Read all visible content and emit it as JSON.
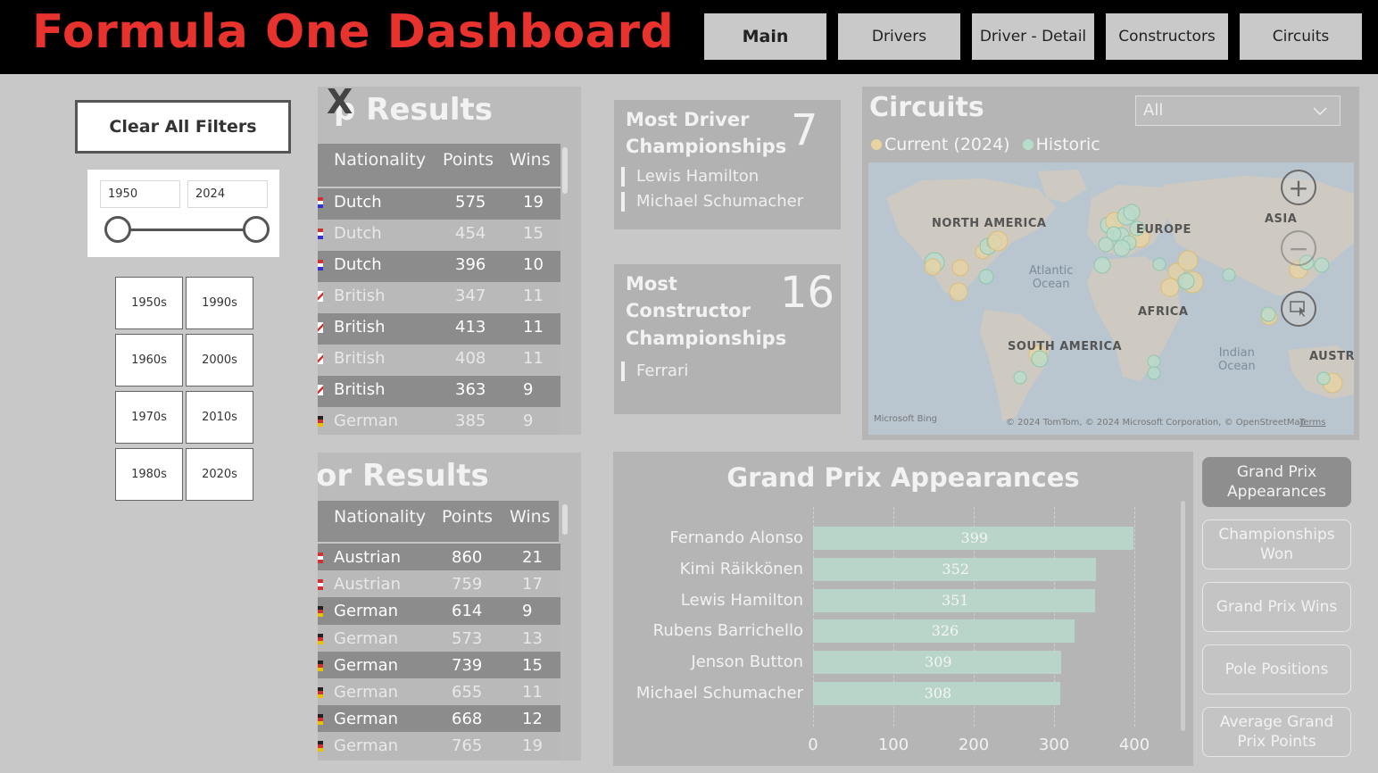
{
  "header": {
    "title": "Formula One Dashboard",
    "nav": [
      "Main",
      "Drivers",
      "Driver - Detail",
      "Constructors",
      "Circuits"
    ]
  },
  "filters": {
    "clear_label": "Clear All Filters",
    "year_from": "1950",
    "year_to": "2024",
    "decades": [
      "1950s",
      "1990s",
      "1960s",
      "2000s",
      "1970s",
      "2010s",
      "1980s",
      "2020s"
    ]
  },
  "close_label": "X",
  "driver_results": {
    "title": "p Results",
    "headers": [
      "Nationality",
      "Points",
      "Wins"
    ],
    "rows": [
      {
        "nat": "Dutch",
        "points": "575",
        "wins": "19"
      },
      {
        "nat": "Dutch",
        "points": "454",
        "wins": "15"
      },
      {
        "nat": "Dutch",
        "points": "396",
        "wins": "10"
      },
      {
        "nat": "British",
        "points": "347",
        "wins": "11"
      },
      {
        "nat": "British",
        "points": "413",
        "wins": "11"
      },
      {
        "nat": "British",
        "points": "408",
        "wins": "11"
      },
      {
        "nat": "British",
        "points": "363",
        "wins": "9"
      },
      {
        "nat": "German",
        "points": "385",
        "wins": "9"
      }
    ]
  },
  "constructor_results": {
    "title": "or Results",
    "headers": [
      "Nationality",
      "Points",
      "Wins"
    ],
    "rows": [
      {
        "nat": "Austrian",
        "points": "860",
        "wins": "21"
      },
      {
        "nat": "Austrian",
        "points": "759",
        "wins": "17"
      },
      {
        "nat": "German",
        "points": "614",
        "wins": "9"
      },
      {
        "nat": "German",
        "points": "573",
        "wins": "13"
      },
      {
        "nat": "German",
        "points": "739",
        "wins": "15"
      },
      {
        "nat": "German",
        "points": "655",
        "wins": "11"
      },
      {
        "nat": "German",
        "points": "668",
        "wins": "12"
      },
      {
        "nat": "German",
        "points": "765",
        "wins": "19"
      }
    ]
  },
  "kpi_driver": {
    "label_line1": "Most Driver",
    "label_line2": "Championships",
    "value": "7",
    "items": [
      "Lewis Hamilton",
      "Michael Schumacher"
    ]
  },
  "kpi_constructor": {
    "label_line1": "Most",
    "label_line2": "Constructor",
    "label_line3": "Championships",
    "value": "16",
    "items": [
      "Ferrari"
    ]
  },
  "circuits": {
    "title": "Circuits",
    "dropdown_value": "All",
    "legend": [
      {
        "label": "Current (2024)",
        "color": "#e9d3a0"
      },
      {
        "label": "Historic",
        "color": "#b8dccb"
      }
    ],
    "map_labels": [
      "NORTH AMERICA",
      "EUROPE",
      "ASIA",
      "AFRICA",
      "SOUTH AMERICA",
      "AUSTRA"
    ],
    "ocean_labels": [
      "Atlantic\nOcean",
      "Indian\nOcean"
    ],
    "attribution_left": "Microsoft Bing",
    "attribution_right": "© 2024 TomTom, © 2024 Microsoft Corporation, © OpenStreetMap",
    "terms": "Terms"
  },
  "grand_prix": {
    "title": "Grand Prix Appearances",
    "axis_ticks": [
      "0",
      "100",
      "200",
      "300",
      "400"
    ]
  },
  "chart_data": {
    "type": "bar",
    "orientation": "horizontal",
    "title": "Grand Prix Appearances",
    "categories": [
      "Fernando Alonso",
      "Kimi Räikkönen",
      "Lewis Hamilton",
      "Rubens Barrichello",
      "Jenson Button",
      "Michael Schumacher"
    ],
    "values": [
      399,
      352,
      351,
      326,
      309,
      308
    ],
    "xlim": [
      0,
      400
    ],
    "grid": true,
    "bar_color": "#b9d4c9"
  },
  "metrics": [
    "Grand Prix Appearances",
    "Championships Won",
    "Grand Prix Wins",
    "Pole Positions",
    "Average Grand Prix Points"
  ]
}
